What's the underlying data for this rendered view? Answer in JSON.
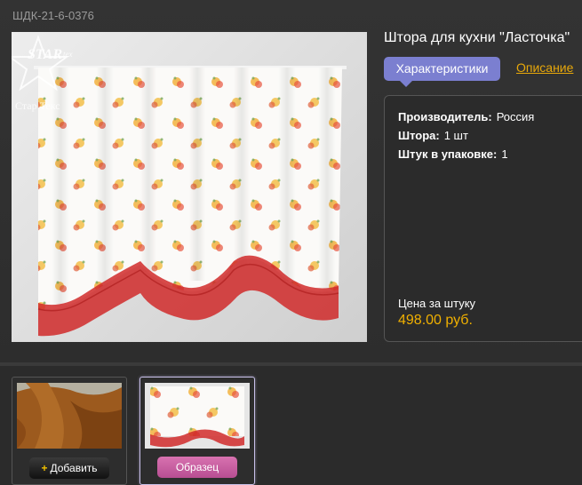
{
  "product": {
    "sku": "ШДК-21-6-0376",
    "title": "Штора для кухни \"Ласточка\"",
    "logo_text": "Стар Текс"
  },
  "tabs": {
    "active": "Характеристики",
    "other": "Описание"
  },
  "specs": [
    {
      "label": "Производитель:",
      "value": "Россия"
    },
    {
      "label": "Штора:",
      "value": "1 шт"
    },
    {
      "label": "Штук в упаковке:",
      "value": "1"
    }
  ],
  "price": {
    "label": "Цена за штуку",
    "value": "498.00 руб."
  },
  "thumbnails": [
    {
      "button": "Добавить",
      "button_plus": "+"
    },
    {
      "button": "Образец"
    }
  ],
  "colors": {
    "tab_active": "#7b7fd0",
    "link": "#e8a80a",
    "price": "#f0b000",
    "sample_button": "#c85ea2"
  },
  "icons": [
    "star-logo-icon",
    "plus-icon"
  ]
}
